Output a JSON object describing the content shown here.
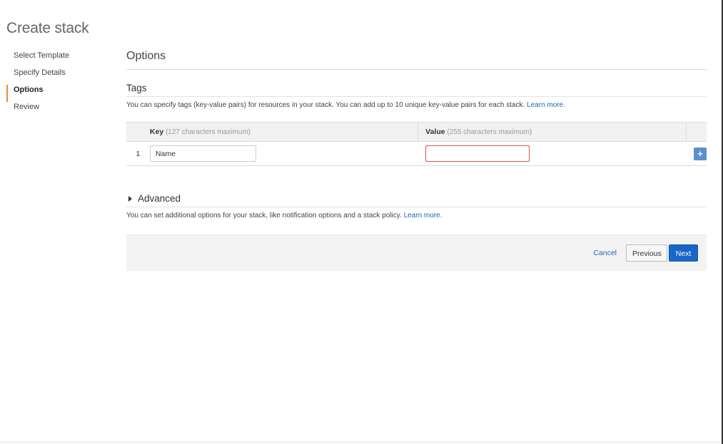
{
  "page_title": "Create stack",
  "wizard_steps": [
    {
      "label": "Select Template",
      "active": false
    },
    {
      "label": "Specify Details",
      "active": false
    },
    {
      "label": "Options",
      "active": true
    },
    {
      "label": "Review",
      "active": false
    }
  ],
  "options": {
    "title": "Options",
    "tags": {
      "title": "Tags",
      "description": "You can specify tags (key-value pairs) for resources in your stack. You can add up to 10 unique key-value pairs for each stack.",
      "learn_more": "Learn more.",
      "columns": {
        "key_label": "Key",
        "key_hint": "(127 characters maximum)",
        "value_label": "Value",
        "value_hint": "(255 characters maximum)"
      },
      "rows": [
        {
          "index": "1",
          "key": "Name",
          "value": ""
        }
      ],
      "add_button": "+"
    },
    "advanced": {
      "title": "Advanced",
      "description": "You can set additional options for your stack, like notification options and a stack policy.",
      "learn_more": "Learn more."
    }
  },
  "footer": {
    "cancel": "Cancel",
    "previous": "Previous",
    "next": "Next"
  },
  "colors": {
    "active_step_marker": "#e88e2b",
    "link": "#1a66b8",
    "primary_button": "#1a66c6",
    "add_button": "#5b8fd0",
    "error_border": "#d9534f"
  }
}
